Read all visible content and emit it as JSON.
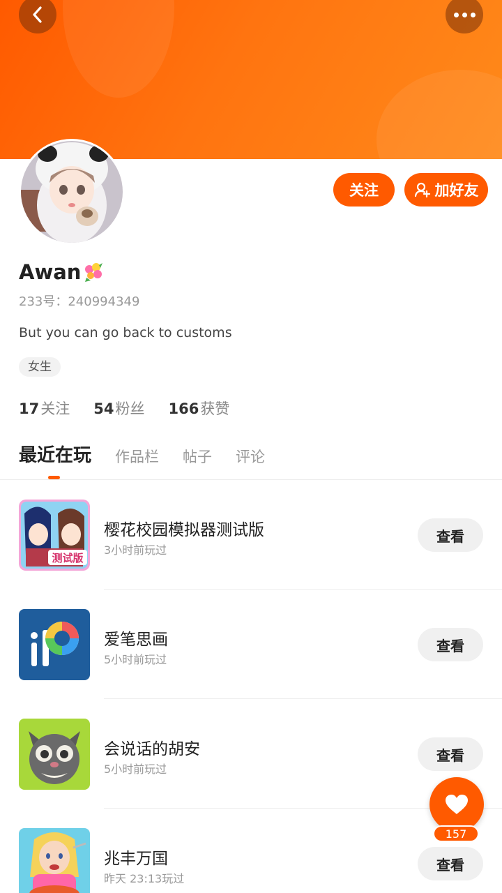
{
  "header": {
    "back_icon": "chevron-left-icon",
    "more_icon": "more-dots-icon"
  },
  "profile": {
    "name": "Awan",
    "name_emoji": "bouquet-icon",
    "id_label": "233号：240994349",
    "bio": "But you can go back to customs",
    "tag": "女生",
    "follow_label": "关注",
    "add_friend_label": "加好友",
    "stats": [
      {
        "count": "17",
        "label": "关注"
      },
      {
        "count": "54",
        "label": "粉丝"
      },
      {
        "count": "166",
        "label": "获赞"
      }
    ]
  },
  "tabs": [
    {
      "label": "最近在玩",
      "active": true
    },
    {
      "label": "作品栏",
      "active": false
    },
    {
      "label": "帖子",
      "active": false
    },
    {
      "label": "评论",
      "active": false
    }
  ],
  "games": [
    {
      "name": "樱花校园模拟器测试版",
      "time": "3小时前玩过",
      "button": "查看"
    },
    {
      "name": "爱笔思画",
      "time": "5小时前玩过",
      "button": "查看"
    },
    {
      "name": "会说话的胡安",
      "time": "5小时前玩过",
      "button": "查看"
    },
    {
      "name": "兆丰万国",
      "time": "昨天 23:13玩过",
      "button": "查看"
    }
  ],
  "like_fab": {
    "count": "157",
    "icon": "heart-icon"
  },
  "colors": {
    "accent": "#ff5a00",
    "banner_start": "#ff5a00",
    "banner_end": "#ff8a1a"
  }
}
